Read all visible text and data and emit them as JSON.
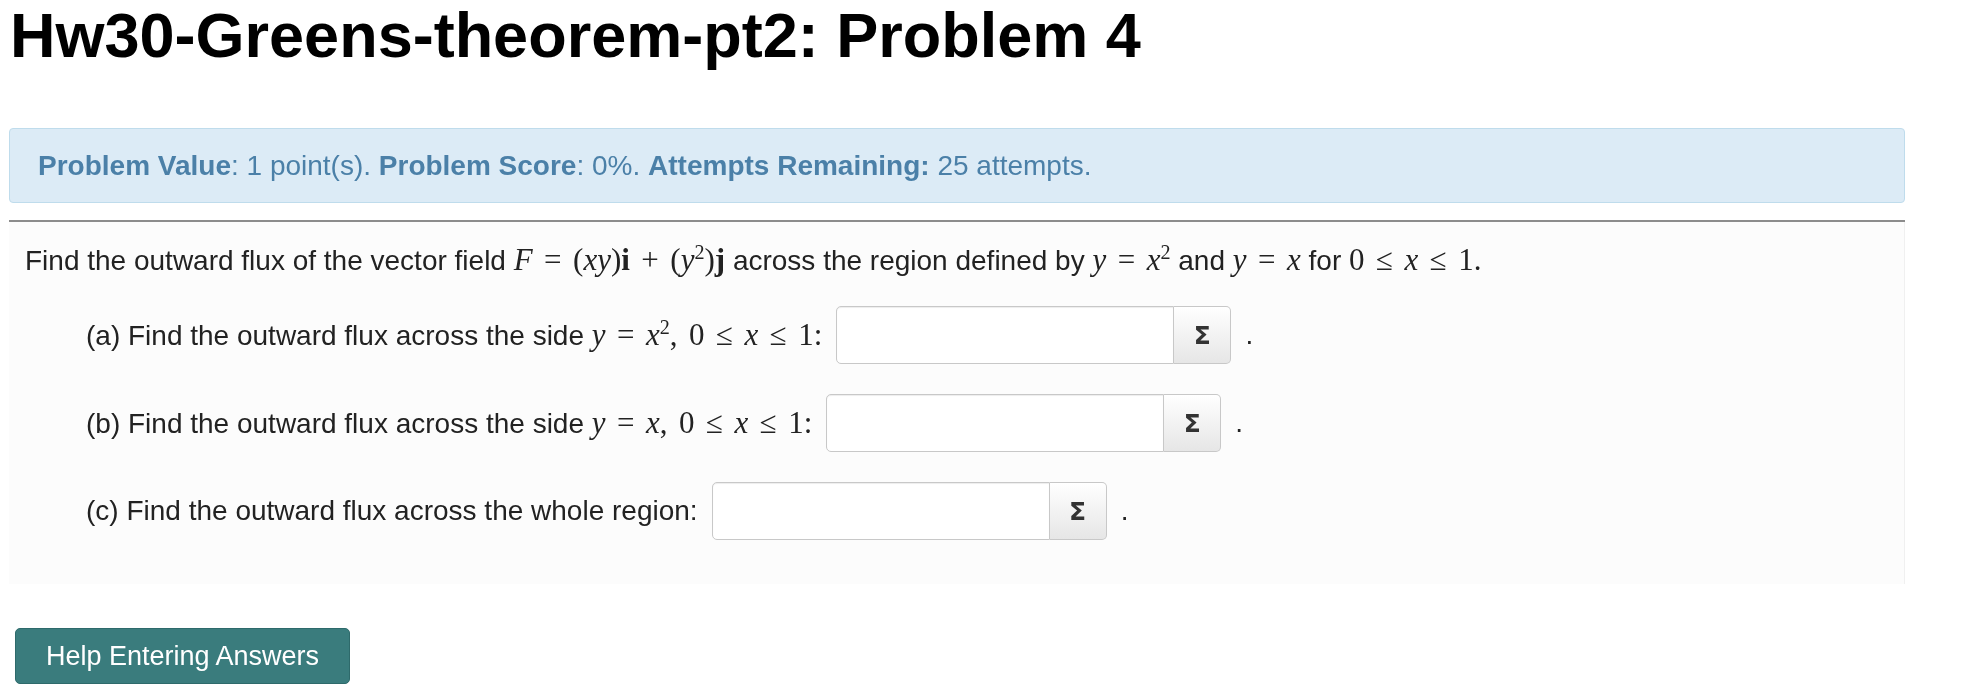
{
  "title": "Hw30-Greens-theorem-pt2: Problem 4",
  "status_banner": "**Problem Value**: 1 point(s). **Problem Score**: 0%. **Attempts Remaining:** 25 attempts.",
  "problem": {
    "statement": [
      {
        "kind": "text",
        "text": "Find the outward flux of the vector field "
      },
      {
        "kind": "math",
        "text": "*F* = (*xy*)**i** + (*y*$^{2}$)**j**"
      },
      {
        "kind": "text",
        "text": " across the region defined by "
      },
      {
        "kind": "math",
        "text": "*y* = *x*$^{2}$"
      },
      {
        "kind": "text",
        "text": " and "
      },
      {
        "kind": "math",
        "text": "*y* = *x*"
      },
      {
        "kind": "text",
        "text": " for "
      },
      {
        "kind": "math",
        "text": "0 ≤ *x* ≤ 1."
      }
    ],
    "parts": [
      {
        "question": [
          {
            "kind": "text",
            "text": "(a) Find the outward flux across the side "
          },
          {
            "kind": "math",
            "text": "*y* = *x*$^{2}$, 0 ≤ *x* ≤ 1:"
          }
        ],
        "equation_button": "Σ",
        "suffix": "."
      },
      {
        "question": [
          {
            "kind": "text",
            "text": "(b) Find the outward flux across the side "
          },
          {
            "kind": "math",
            "text": "*y* = *x*, 0 ≤ *x* ≤ 1:"
          }
        ],
        "equation_button": "Σ",
        "suffix": "."
      },
      {
        "question": [
          {
            "kind": "text",
            "text": "(c) Find the outward flux across the whole region:"
          }
        ],
        "equation_button": "Σ",
        "suffix": "."
      }
    ]
  },
  "help_button": "Help Entering Answers"
}
